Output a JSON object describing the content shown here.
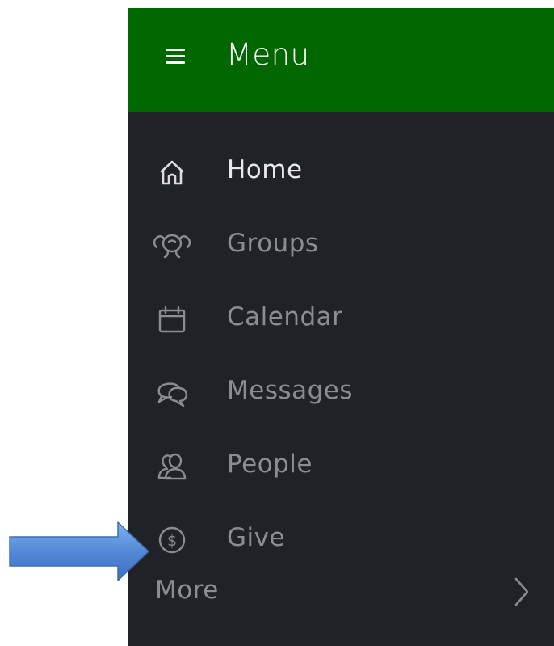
{
  "header": {
    "title": "Menu",
    "background_color": "#006600",
    "menu_icon": "hamburger-icon"
  },
  "nav": {
    "background_color": "#212227",
    "items": [
      {
        "label": "Home",
        "icon": "home-icon",
        "active": true
      },
      {
        "label": "Groups",
        "icon": "groups-icon",
        "active": false
      },
      {
        "label": "Calendar",
        "icon": "calendar-icon",
        "active": false
      },
      {
        "label": "Messages",
        "icon": "messages-icon",
        "active": false
      },
      {
        "label": "People",
        "icon": "people-icon",
        "active": false
      },
      {
        "label": "Give",
        "icon": "dollar-icon",
        "active": false
      }
    ],
    "more": {
      "label": "More",
      "icon": "chevron-right-icon"
    }
  },
  "annotation": {
    "icon": "arrow-right-icon",
    "color": "#5b8fd6"
  }
}
